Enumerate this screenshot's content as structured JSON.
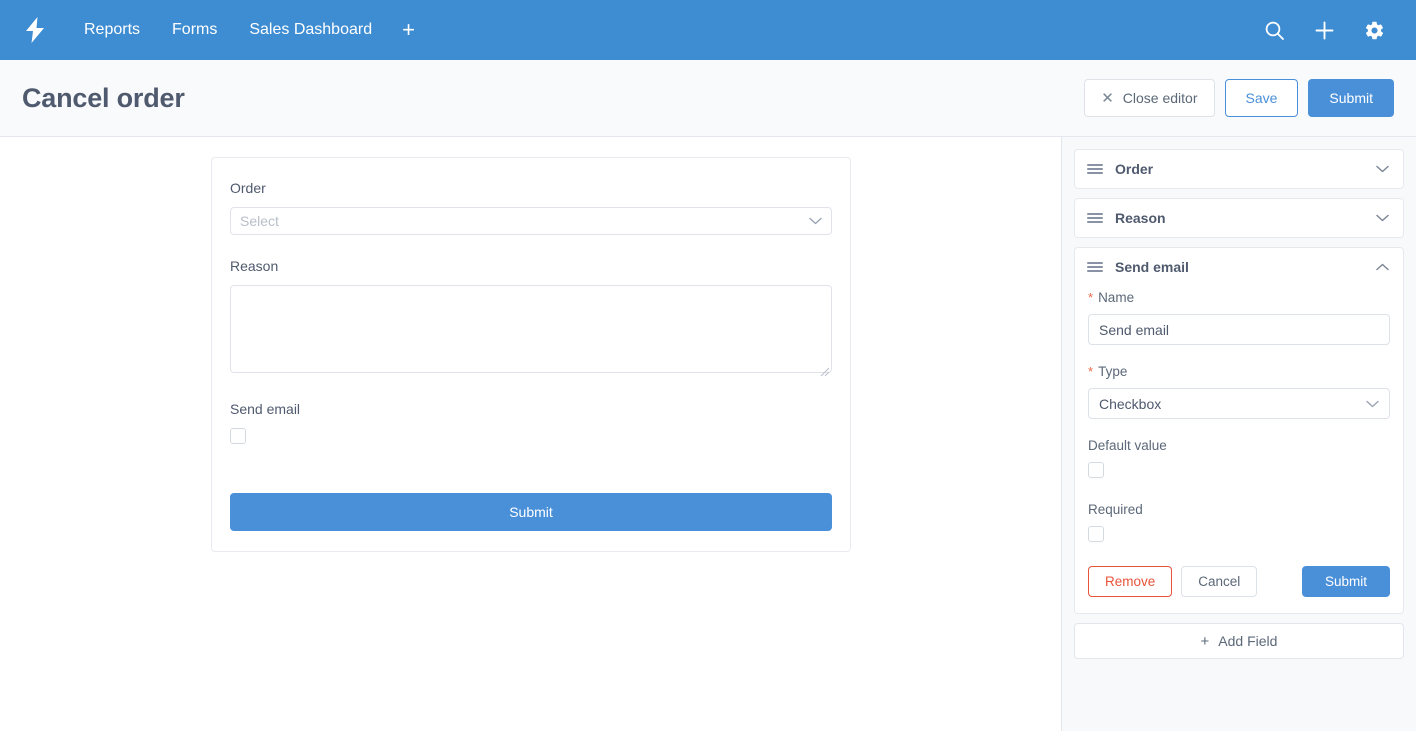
{
  "navbar": {
    "logo_icon": "lightning-bolt-icon",
    "links": [
      {
        "label": "Reports"
      },
      {
        "label": "Forms"
      },
      {
        "label": "Sales Dashboard"
      }
    ],
    "add_tab_label": "+",
    "icons": [
      {
        "name": "search-icon"
      },
      {
        "name": "plus-icon"
      },
      {
        "name": "gear-icon"
      }
    ]
  },
  "header": {
    "title": "Cancel order",
    "close_editor_label": "Close editor",
    "close_icon": "close-x-icon",
    "save_label": "Save",
    "submit_label": "Submit"
  },
  "form_preview": {
    "fields": [
      {
        "label": "Order",
        "type": "select",
        "placeholder": "Select",
        "value": ""
      },
      {
        "label": "Reason",
        "type": "textarea",
        "value": ""
      },
      {
        "label": "Send email",
        "type": "checkbox",
        "checked": false
      }
    ],
    "submit_label": "Submit"
  },
  "sidebar": {
    "panels": [
      {
        "title": "Order",
        "expanded": false,
        "chevron": "chevron-down-icon"
      },
      {
        "title": "Reason",
        "expanded": false,
        "chevron": "chevron-down-icon"
      },
      {
        "title": "Send email",
        "expanded": true,
        "chevron": "chevron-up-icon"
      }
    ],
    "editor": {
      "name_label": "Name",
      "name_required": "*",
      "name_value": "Send email",
      "type_label": "Type",
      "type_required": "*",
      "type_value": "Checkbox",
      "default_value_label": "Default value",
      "default_value_checked": false,
      "required_label": "Required",
      "required_checked": false,
      "remove_label": "Remove",
      "cancel_label": "Cancel",
      "submit_label": "Submit"
    },
    "add_field_label": "Add Field",
    "add_field_icon": "plus-icon"
  },
  "colors": {
    "brand_blue": "#3e8cd1",
    "accent_blue": "#4a90d9",
    "danger_red": "#e8533a",
    "required_star": "#e8694a",
    "text_dark": "#4f5a6e",
    "sidebar_bg": "#f7f9fb",
    "header_bg": "#f9fafc"
  }
}
